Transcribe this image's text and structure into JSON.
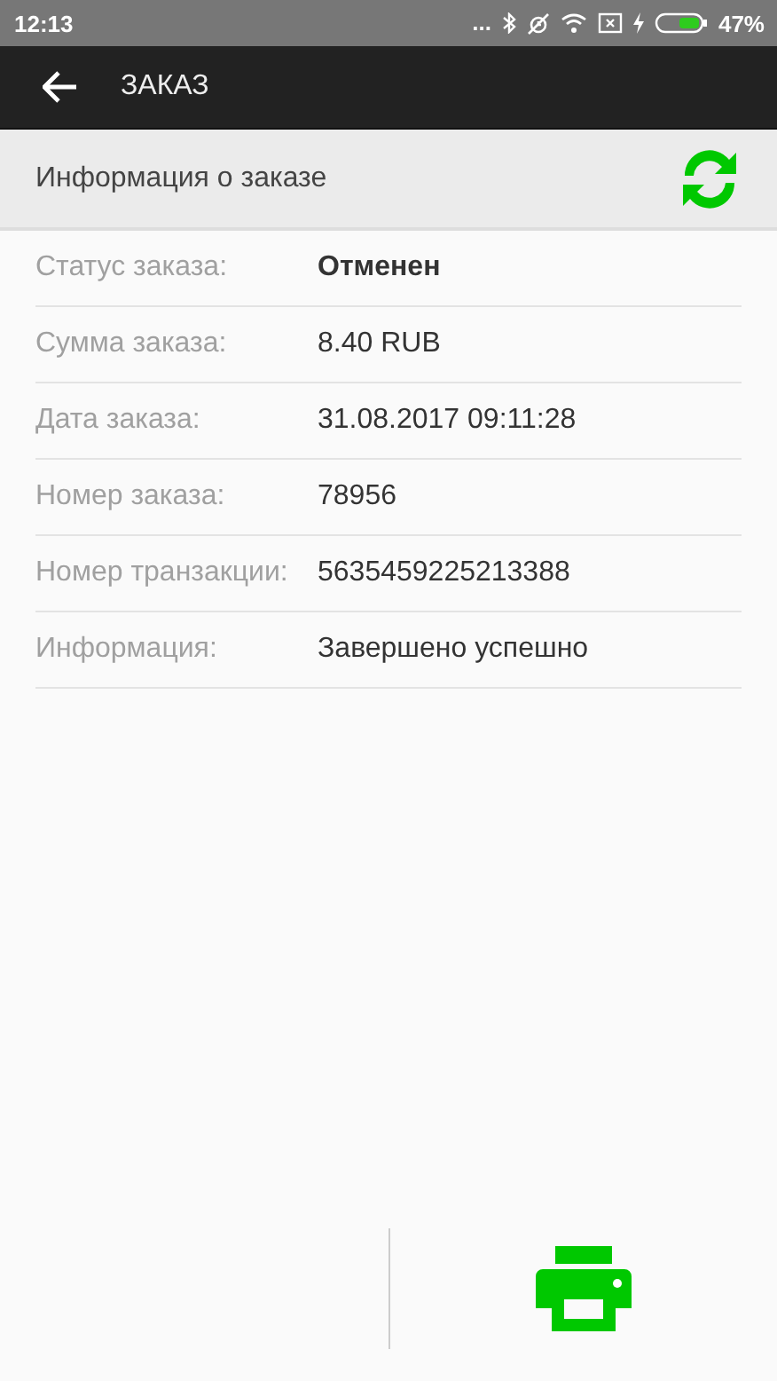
{
  "status_bar": {
    "time": "12:13",
    "dots": "...",
    "battery_text": "47%"
  },
  "app_bar": {
    "title": "ЗАКАЗ"
  },
  "section": {
    "title": "Информация о заказе"
  },
  "rows": [
    {
      "label": "Статус заказа:",
      "value": "Отменен",
      "emphasis": true
    },
    {
      "label": "Сумма заказа:",
      "value": "8.40 RUB",
      "emphasis": false
    },
    {
      "label": "Дата заказа:",
      "value": "31.08.2017 09:11:28",
      "emphasis": false
    },
    {
      "label": "Номер заказа:",
      "value": "78956",
      "emphasis": false
    },
    {
      "label": "Номер транзакции:",
      "value": "5635459225213388",
      "emphasis": false
    },
    {
      "label": "Информация:",
      "value": "Завершено успешно",
      "emphasis": false
    }
  ]
}
